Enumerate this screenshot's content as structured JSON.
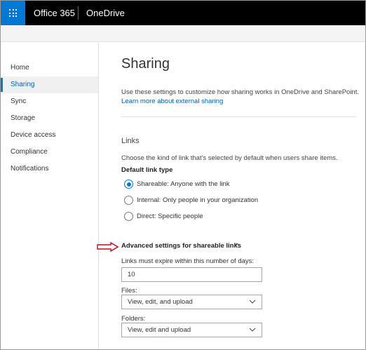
{
  "topbar": {
    "brand": "Office 365",
    "app": "OneDrive",
    "accent": "#0078d4"
  },
  "sidebar": {
    "items": [
      {
        "label": "Home"
      },
      {
        "label": "Sharing",
        "active": true
      },
      {
        "label": "Sync"
      },
      {
        "label": "Storage"
      },
      {
        "label": "Device access"
      },
      {
        "label": "Compliance"
      },
      {
        "label": "Notifications"
      }
    ]
  },
  "main": {
    "title": "Sharing",
    "description": "Use these settings to customize how sharing works in OneDrive and SharePoint.",
    "learn_more": "Learn more about external sharing",
    "links_heading": "Links",
    "links_description": "Choose the kind of link that's selected by default when users share items.",
    "default_link_type_label": "Default link type",
    "options": [
      {
        "label": "Shareable: Anyone with the link",
        "selected": true
      },
      {
        "label": "Internal: Only people in your organization",
        "selected": false
      },
      {
        "label": "Direct: Specific people",
        "selected": false
      }
    ],
    "advanced_label": "Advanced settings for shareable links",
    "expire_label": "Links must expire within this number of days:",
    "expire_value": "10",
    "files_label": "Files:",
    "files_value": "View, edit, and upload",
    "folders_label": "Folders:",
    "folders_value": "View, edit and upload"
  }
}
